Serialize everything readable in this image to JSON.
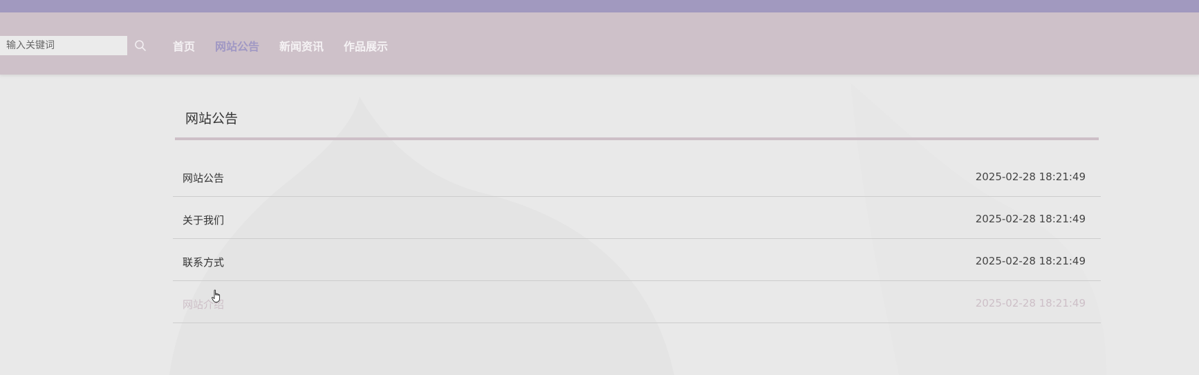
{
  "search": {
    "placeholder": "输入关键词",
    "value": ""
  },
  "nav": {
    "items": [
      {
        "label": "首页",
        "active": false
      },
      {
        "label": "网站公告",
        "active": true
      },
      {
        "label": "新闻资讯",
        "active": false
      },
      {
        "label": "作品展示",
        "active": false
      }
    ]
  },
  "section": {
    "title": "网站公告"
  },
  "notices": [
    {
      "title": "网站公告",
      "time": "2025-02-28 18:21:49"
    },
    {
      "title": "关于我们",
      "time": "2025-02-28 18:21:49"
    },
    {
      "title": "联系方式",
      "time": "2025-02-28 18:21:49"
    },
    {
      "title": "网站介绍",
      "time": "2025-02-28 18:21:49"
    }
  ],
  "colors": {
    "top_strip": "#a199bf",
    "header": "#cec1c9",
    "active_nav": "#a098c4",
    "page_bg": "#e9e9e9"
  },
  "icons": {
    "search": "search-icon",
    "cursor": "hand-cursor-icon"
  }
}
